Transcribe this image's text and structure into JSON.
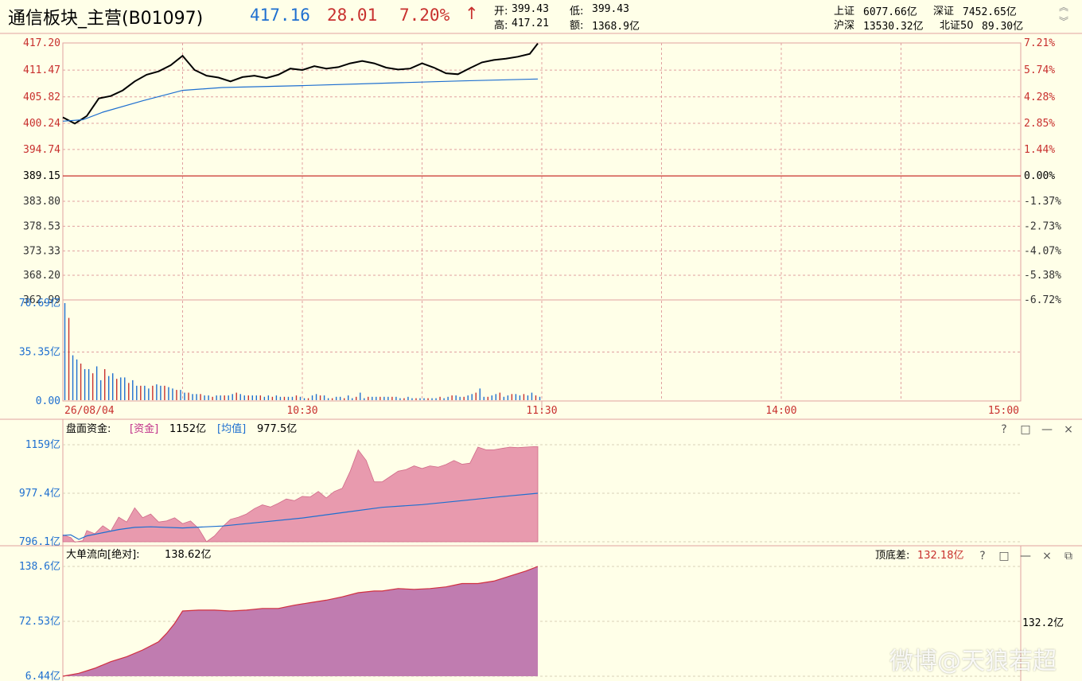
{
  "header": {
    "title": "通信板块_主营(B01097)",
    "price": "417.16",
    "change": "28.01",
    "change_pct": "7.20%",
    "arrow": "↑",
    "open_label": "开:",
    "open": "399.43",
    "high_label": "高:",
    "high": "417.21",
    "low_label": "低:",
    "low": "399.43",
    "amount_label": "额:",
    "amount": "1368.9亿",
    "indices": [
      {
        "label": "上证",
        "value": "6077.66亿"
      },
      {
        "label": "深证",
        "value": "7452.65亿"
      },
      {
        "label": "沪深",
        "value": "13530.32亿"
      },
      {
        "label": "北证50",
        "value": "89.30亿"
      }
    ]
  },
  "panel_money": {
    "label": "盘面资金:",
    "fund_tag": "[资金]",
    "fund_value": "1152亿",
    "avg_tag": "[均值]",
    "avg_value": "977.5亿"
  },
  "panel_flow": {
    "label": "大单流向[绝对]:",
    "value": "138.62亿",
    "spread_label": "顶底差:",
    "spread_value": "132.18亿",
    "side_value": "132.2亿"
  },
  "watermark": "微博@天狼若超",
  "colors": {
    "background": "#FFFFE8",
    "grid_red": "#E0A0A0",
    "up_red": "#C8302E",
    "axis_blue": "#1E6FD0",
    "price_line": "#000000",
    "avg_line": "#1E6FD0",
    "money_fill": "#E89AAE",
    "flow_fill": "#C07CB0"
  },
  "chart_data": [
    {
      "type": "line",
      "name": "intraday-price",
      "ylim": [
        362.99,
        417.2
      ],
      "y_ticks": [
        "417.20",
        "411.47",
        "405.82",
        "400.24",
        "394.74",
        "389.15",
        "383.80",
        "378.53",
        "373.33",
        "368.20",
        "362.99"
      ],
      "y_tick_values": [
        417.2,
        411.47,
        405.82,
        400.24,
        394.74,
        389.15,
        383.8,
        378.53,
        373.33,
        368.2,
        362.99
      ],
      "right_ticks": [
        "7.21%",
        "5.74%",
        "4.28%",
        "2.85%",
        "1.44%",
        "0.00%",
        "-1.37%",
        "-2.73%",
        "-4.07%",
        "-5.38%",
        "-6.72%"
      ],
      "base": 389.15,
      "x_ticks": [
        "26/08/04",
        "10:30",
        "11:30",
        "14:00",
        "15:00"
      ],
      "x_tick_minutes": [
        0,
        60,
        120,
        180,
        240
      ],
      "total_minutes": 240,
      "series": [
        {
          "kind": "price",
          "x": [
            0,
            3,
            6,
            9,
            12,
            15,
            18,
            21,
            24,
            27,
            30,
            33,
            36,
            39,
            42,
            45,
            48,
            51,
            54,
            57,
            60,
            63,
            66,
            69,
            72,
            75,
            78,
            81,
            84,
            87,
            90,
            93,
            96,
            99,
            102,
            105,
            108,
            111,
            114,
            117,
            119
          ],
          "values": [
            401.5,
            400.2,
            401.8,
            405.5,
            406.0,
            407.2,
            409.1,
            410.5,
            411.2,
            412.5,
            414.5,
            411.5,
            410.3,
            409.9,
            409.1,
            410.0,
            410.3,
            409.8,
            410.5,
            411.8,
            411.5,
            412.3,
            411.8,
            412.1,
            412.9,
            413.4,
            412.9,
            412.0,
            411.6,
            411.8,
            412.9,
            412.0,
            410.8,
            410.6,
            411.9,
            413.1,
            413.6,
            413.9,
            414.3,
            414.9,
            417.1
          ]
        },
        {
          "kind": "avg",
          "x": [
            0,
            5,
            10,
            20,
            30,
            40,
            60,
            80,
            100,
            119
          ],
          "values": [
            400.7,
            401.0,
            402.6,
            405.0,
            407.2,
            407.8,
            408.2,
            408.7,
            409.2,
            409.6
          ]
        }
      ]
    },
    {
      "type": "bar",
      "name": "volume",
      "y_ticks": [
        "70.69亿",
        "35.35亿",
        "0.00"
      ],
      "y_tick_values": [
        70.69,
        35.35,
        0
      ],
      "ylim": [
        0,
        70.69
      ],
      "values": [
        70.69,
        60.0,
        33,
        30,
        27,
        23,
        23,
        20,
        25,
        15,
        23,
        18,
        20,
        16,
        17,
        17,
        13,
        15,
        11,
        11,
        11,
        9,
        11,
        12,
        11,
        11,
        10,
        9,
        8,
        8,
        6,
        6,
        5,
        5,
        5,
        4,
        4,
        3,
        4,
        4,
        4,
        4,
        5,
        6,
        5,
        4,
        4,
        4,
        4,
        4,
        3,
        4,
        3,
        4,
        3,
        3,
        3,
        3,
        4,
        3,
        2,
        2,
        4,
        5,
        4,
        4,
        2,
        2,
        3,
        3,
        2,
        4,
        2,
        3,
        6,
        2,
        3,
        3,
        3,
        3,
        3,
        3,
        3,
        3,
        2,
        2,
        3,
        2,
        2,
        2,
        2,
        2,
        2,
        2,
        3,
        2,
        3,
        4,
        4,
        3,
        3,
        4,
        5,
        6,
        9,
        3,
        3,
        4,
        5,
        6,
        3,
        4,
        5,
        5,
        4,
        5,
        4,
        6,
        4,
        3
      ]
    },
    {
      "type": "area",
      "name": "money",
      "y_ticks": [
        "1159亿",
        "977.4亿",
        "796.1亿"
      ],
      "y_tick_values": [
        1159,
        977.4,
        796.1
      ],
      "ylim": [
        796.1,
        1159
      ],
      "series": [
        {
          "kind": "fund",
          "x": [
            0,
            2,
            3,
            5,
            6,
            8,
            10,
            12,
            14,
            16,
            18,
            20,
            22,
            24,
            26,
            28,
            30,
            32,
            34,
            36,
            38,
            40,
            42,
            44,
            46,
            48,
            50,
            52,
            54,
            56,
            58,
            60,
            62,
            64,
            66,
            68,
            70,
            72,
            74,
            76,
            78,
            80,
            82,
            84,
            86,
            88,
            90,
            92,
            94,
            96,
            98,
            100,
            102,
            104,
            106,
            108,
            110,
            112,
            114,
            116,
            118,
            119
          ],
          "values": [
            822,
            812,
            795,
            800,
            838,
            826,
            856,
            836,
            888,
            870,
            923,
            886,
            900,
            870,
            874,
            886,
            864,
            874,
            846,
            796,
            818,
            852,
            880,
            888,
            900,
            920,
            934,
            926,
            940,
            956,
            950,
            966,
            964,
            984,
            960,
            984,
            996,
            1060,
            1140,
            1100,
            1020,
            1020,
            1040,
            1060,
            1066,
            1080,
            1070,
            1080,
            1075,
            1085,
            1100,
            1086,
            1090,
            1150,
            1140,
            1140,
            1145,
            1150,
            1148,
            1150,
            1152,
            1152
          ]
        },
        {
          "kind": "avg",
          "x": [
            0,
            2,
            4,
            6,
            10,
            14,
            18,
            22,
            30,
            40,
            50,
            60,
            70,
            80,
            90,
            100,
            110,
            119
          ],
          "values": [
            820,
            822,
            805,
            818,
            830,
            842,
            850,
            852,
            848,
            855,
            870,
            885,
            905,
            925,
            935,
            950,
            965,
            977.5
          ]
        }
      ]
    },
    {
      "type": "area",
      "name": "big-order-flow",
      "y_ticks": [
        "138.6亿",
        "72.53亿",
        "6.44亿"
      ],
      "y_tick_values": [
        138.6,
        72.53,
        6.44
      ],
      "ylim": [
        6.44,
        138.6
      ],
      "x": [
        0,
        4,
        8,
        12,
        16,
        20,
        24,
        26,
        28,
        30,
        34,
        38,
        42,
        46,
        50,
        54,
        58,
        62,
        66,
        70,
        74,
        78,
        80,
        84,
        88,
        92,
        96,
        100,
        104,
        108,
        112,
        116,
        119
      ],
      "values": [
        6.44,
        10,
        16,
        24,
        30,
        38,
        48,
        58,
        70,
        85,
        86,
        86,
        85,
        86,
        88,
        88,
        92,
        95,
        98,
        102,
        107,
        109,
        109,
        112,
        111,
        112,
        114,
        118,
        118,
        121,
        127,
        133,
        138.62
      ]
    }
  ]
}
